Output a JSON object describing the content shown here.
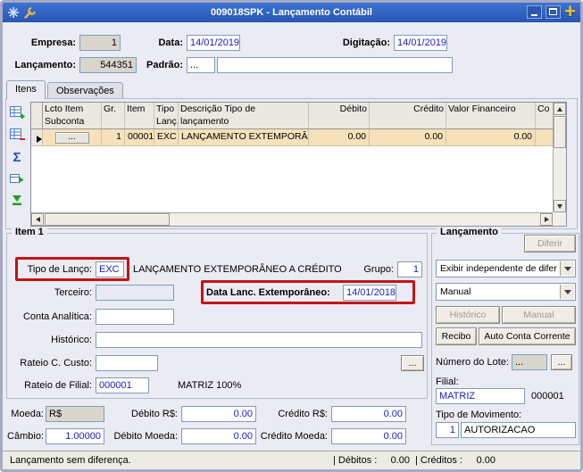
{
  "titlebar": {
    "title": "009018SPK - Lançamento Contábil",
    "close_glyph": "+"
  },
  "header": {
    "empresa": {
      "label": "Empresa:",
      "value": "1"
    },
    "data": {
      "label": "Data:",
      "value": "14/01/2019"
    },
    "digitacao": {
      "label": "Digitação:",
      "value": "14/01/2019"
    },
    "lancamento": {
      "label": "Lançamento:",
      "value": "544351"
    },
    "padrao": {
      "label": "Padrão:",
      "value": "...",
      "desc": ""
    }
  },
  "tabs": {
    "itens": "Itens",
    "observacoes": "Observações"
  },
  "grid": {
    "columns": [
      "Lcto Item\nSubconta",
      "Gr.",
      "Item",
      "Tipo\nLanç.",
      "Descrição Tipo de lançamento",
      "Débito",
      "Crédito",
      "Valor Financeiro",
      "Co"
    ],
    "row": {
      "subconta": "...",
      "gr": "1",
      "item": "00001",
      "tipo": "EXC",
      "descricao": "LANÇAMENTO EXTEMPORÂNE",
      "debito": "0.00",
      "credito": "0.00",
      "valor": "0.00"
    },
    "toolbar": {
      "sum_glyph": "Σ"
    }
  },
  "item": {
    "title": "Item 1",
    "tipo_label": "Tipo de Lanço:",
    "tipo_value": "EXC",
    "tipo_desc": "LANÇAMENTO EXTEMPORÂNEO A CRÉDITO",
    "grupo_label": "Grupo:",
    "grupo_value": "1",
    "terceiro_label": "Terceiro:",
    "terceiro_value": "",
    "data_ext_label": "Data Lanc. Extemporâneo:",
    "data_ext_value": "14/01/2018",
    "conta_label": "Conta Analítica:",
    "conta_value": "",
    "historico_label": "Histórico:",
    "historico_value": "",
    "rateio_custo_label": "Rateio C. Custo:",
    "rateio_custo_value": "",
    "ellipsis": "...",
    "rateio_filial_label": "Rateio de Filial:",
    "rateio_filial_value": "000001",
    "rateio_filial_desc": "MATRIZ 100%",
    "moeda_label": "Moeda:",
    "moeda_value": "R$",
    "debito_rs_label": "Débito R$:",
    "debito_rs_value": "0.00",
    "credito_rs_label": "Crédito R$:",
    "credito_rs_value": "0.00",
    "cambio_label": "Câmbio:",
    "cambio_value": "1.00000",
    "debito_moeda_label": "Débito Moeda:",
    "debito_moeda_value": "0.00",
    "credito_moeda_label": "Crédito Moeda:",
    "credito_moeda_value": "0.00"
  },
  "lanc": {
    "title": "Lançamento",
    "diferir": "Diferir",
    "combo_exibir": "Exibir independente de difer",
    "combo_manual": "Manual",
    "btn_historico": "Histórico",
    "btn_manual": "Manual",
    "btn_recibo": "Recibo",
    "btn_auto": "Auto Conta Corrente",
    "lote_label": "Número do Lote:",
    "lote_value": "...",
    "lote_btn": "...",
    "filial_label": "Filial:",
    "filial_value": "MATRIZ",
    "filial_code": "000001",
    "mov_label": "Tipo de Movimento:",
    "mov_value": "1",
    "mov_desc": "AUTORIZACAO"
  },
  "status": {
    "message": "Lançamento sem diferença.",
    "debitos_label": "| Débitos :",
    "debitos_value": "0.00",
    "creditos_label": "| Créditos :",
    "creditos_value": "0.00"
  }
}
